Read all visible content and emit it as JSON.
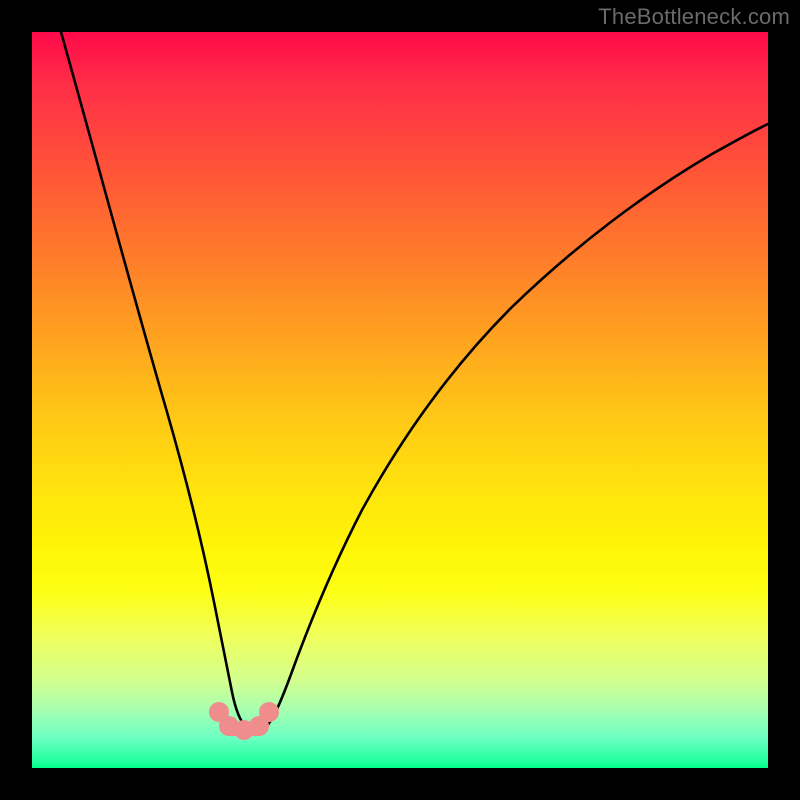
{
  "watermark": "TheBottleneck.com",
  "chart_data": {
    "type": "line",
    "title": "",
    "xlabel": "",
    "ylabel": "",
    "xlim": [
      0,
      100
    ],
    "ylim": [
      0,
      100
    ],
    "series": [
      {
        "name": "bottleneck-curve",
        "x": [
          4,
          6,
          8,
          10,
          12,
          14,
          16,
          18,
          20,
          22,
          24,
          25.5,
          27,
          28,
          29,
          30,
          31,
          32,
          34,
          36,
          38,
          40,
          44,
          48,
          52,
          56,
          60,
          66,
          72,
          80,
          88,
          96,
          100
        ],
        "values": [
          100,
          93,
          86,
          79,
          72,
          64,
          57,
          49,
          41,
          33,
          22,
          13,
          8,
          6,
          5,
          5,
          6,
          8,
          13,
          21,
          28,
          34,
          44,
          51,
          57,
          62,
          66,
          71,
          75,
          80,
          83,
          86,
          87
        ]
      }
    ],
    "markers": [
      {
        "x": 25.2,
        "y": 7.5
      },
      {
        "x": 26.6,
        "y": 5.8
      },
      {
        "x": 28.6,
        "y": 5.2
      },
      {
        "x": 30.6,
        "y": 5.8
      },
      {
        "x": 32.0,
        "y": 7.8
      }
    ],
    "background_gradient": {
      "top": "#ff0a4a",
      "mid": "#ffe30d",
      "bottom": "#00ff88"
    },
    "colors": {
      "curve": "#000000",
      "marker": "#f08080"
    }
  }
}
